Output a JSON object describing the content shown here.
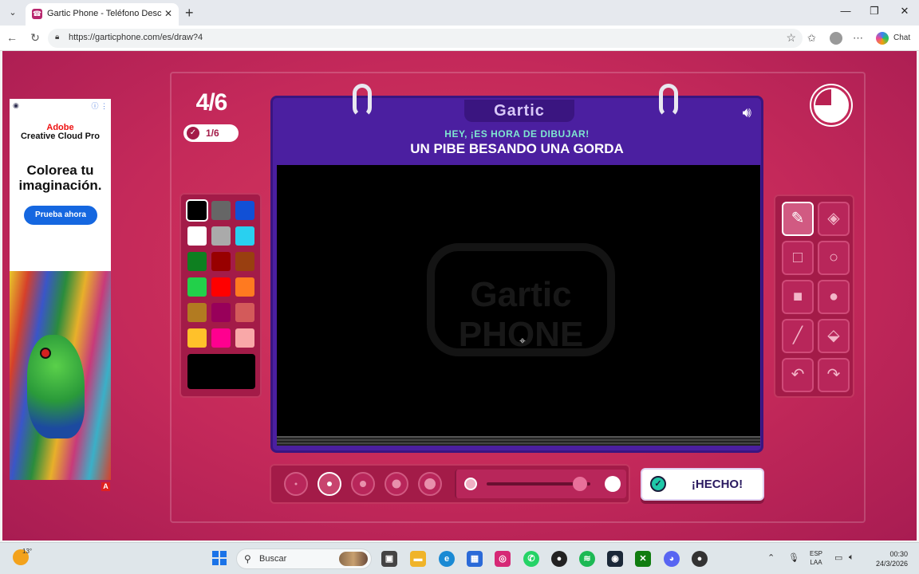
{
  "browser": {
    "tab_title": "Gartic Phone - Teléfono Descompuesto",
    "url": "https://garticphone.com/es/draw?4",
    "chat_label": "Chat"
  },
  "ad": {
    "brand_line1": "Adobe",
    "brand_line2": "Creative Cloud Pro",
    "headline": "Colorea tu imaginación.",
    "cta": "Prueba ahora",
    "badge": "A"
  },
  "game": {
    "round": "4/6",
    "players_done": "1/6",
    "logo": "Gartic",
    "prompt_sub": "HEY, ¡ES HORA DE DIBUJAR!",
    "prompt_main": "UN PIBE BESANDO UNA GORDA",
    "canvas_watermark": "Gartic PHONE",
    "timer_remaining": 0.75,
    "done_button": "¡HECHO!",
    "palette": [
      "#000000",
      "#666666",
      "#1150d6",
      "#ffffff",
      "#aaaaaa",
      "#29d0f0",
      "#0e7f20",
      "#980000",
      "#993f10",
      "#22d04a",
      "#ff0000",
      "#ff7a20",
      "#b27b21",
      "#98005a",
      "#d35a5a",
      "#ffc12a",
      "#ff008f",
      "#f9a8a8"
    ],
    "selected_color": "#000000",
    "selected_brush_size": 2,
    "opacity": 0.9,
    "tools": [
      "pencil",
      "eraser",
      "rectangle-outline",
      "ellipse-outline",
      "rectangle-filled",
      "ellipse-filled",
      "line",
      "fill-bucket",
      "undo",
      "redo"
    ]
  },
  "taskbar": {
    "weather": "13°",
    "search_placeholder": "Buscar",
    "lang_line1": "ESP",
    "lang_line2": "LAA",
    "time": "00:30",
    "date": "24/3/2026"
  }
}
